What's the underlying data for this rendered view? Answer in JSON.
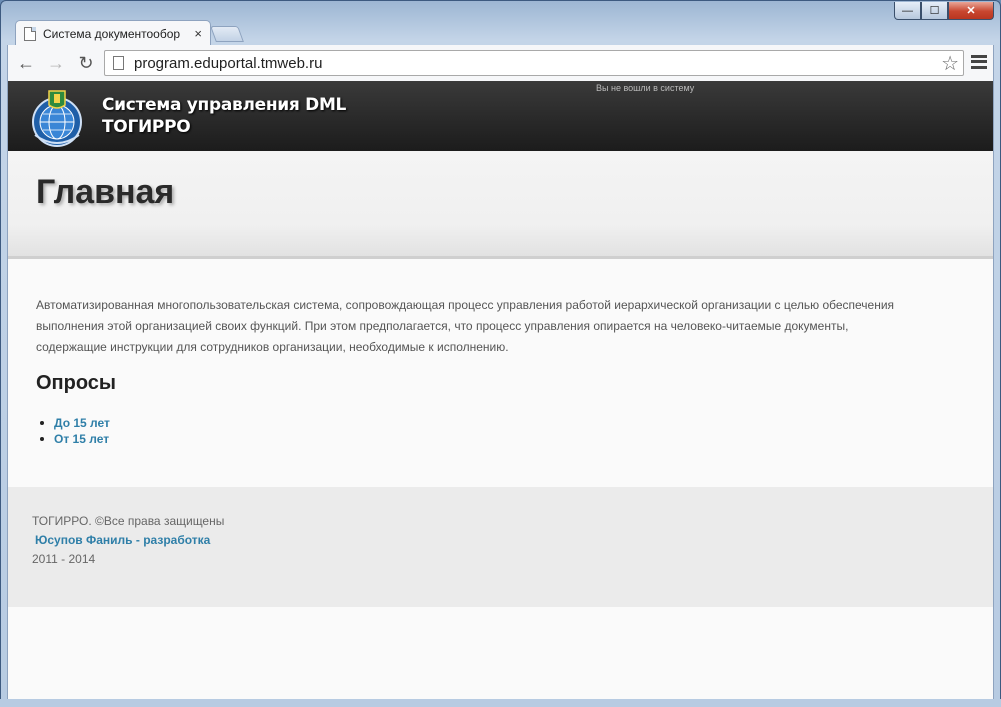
{
  "browser": {
    "tab_title": "Система документообор",
    "tab_close": "×",
    "url": "program.eduportal.tmweb.ru",
    "back_icon": "←",
    "forward_icon": "→",
    "reload_icon": "↻",
    "star_icon": "☆",
    "window_min": "—",
    "window_max": "☐",
    "window_close": "✕"
  },
  "header": {
    "brand_line1": "Система управления DML",
    "brand_line2": "ТОГИРРО",
    "login_status": "Вы не вошли в систему"
  },
  "page": {
    "title": "Главная",
    "intro": "Автоматизированная многопользовательская система, сопровождающая процесс управления работой иерархической организации с целью обеспечения выполнения этой организацией своих функций. При этом предполагается, что процесс управления опирается на человеко-читаемые документы, содержащие инструкции для сотрудников организации, необходимые к исполнению.",
    "polls_title": "Опросы",
    "polls": [
      "До 15 лет",
      "От 15 лет"
    ]
  },
  "footer": {
    "copyright": "ТОГИРРО. ©Все права защищены",
    "developer_link": "Юсупов Фаниль - разработка",
    "years": "2011 - 2014"
  },
  "colors": {
    "link": "#2f7fa8",
    "header_bg": "#2a2a2a"
  }
}
